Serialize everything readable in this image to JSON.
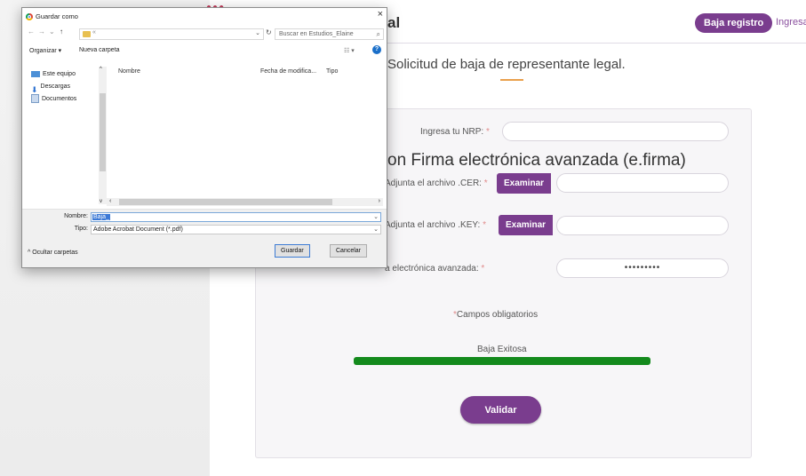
{
  "header": {
    "title_fragment": "al",
    "baja_button": "Baja registro",
    "ingresa_link": "Ingresa"
  },
  "page": {
    "subtitle": "Solicitud de baja de representante legal."
  },
  "form": {
    "nrp_label": "Ingresa tu NRP:",
    "required_mark": "*",
    "section_heading": "on Firma electrónica avanzada (e.firma)",
    "cer_label": "Adjunta el archivo .CER:",
    "key_label": "Adjunta el archivo .KEY:",
    "examinar": "Examinar",
    "password_label": "a electrónica avanzada:",
    "password_value": "•••••••••",
    "campos": "Campos obligatorios",
    "progress_label": "Baja Exitosa",
    "progress_fraction": 1.0,
    "validar": "Validar"
  },
  "dialog": {
    "title": "Guardar como",
    "close": "×",
    "path": "«",
    "search_placeholder": "Buscar en Estudios_Elaine",
    "organize": "Organizar ▾",
    "new_folder": "Nueva carpeta",
    "nav_items": [
      "Este equipo",
      "Descargas",
      "Documentos"
    ],
    "columns": [
      "Nombre",
      "Fecha de modifica...",
      "Tipo"
    ],
    "name_label": "Nombre:",
    "name_value": "Baja_",
    "type_label": "Tipo:",
    "type_value": "Adobe Acrobat Document (*.pdf)",
    "hide_folders": "Ocultar carpetas",
    "save": "Guardar",
    "cancel": "Cancelar"
  },
  "colors": {
    "brand_purple": "#7a3d8e",
    "progress_green": "#148a1d",
    "accent_orange": "#e9a04c"
  }
}
